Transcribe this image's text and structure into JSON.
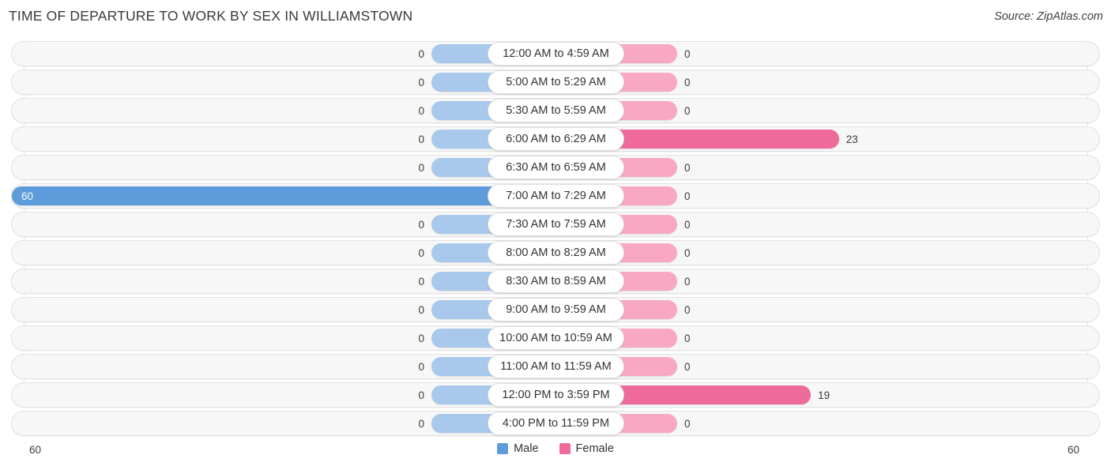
{
  "title": "TIME OF DEPARTURE TO WORK BY SEX IN WILLIAMSTOWN",
  "source": "Source: ZipAtlas.com",
  "axis": {
    "left_label": "60",
    "right_label": "60"
  },
  "legend": {
    "male": {
      "label": "Male",
      "color": "#5D9BDB"
    },
    "female": {
      "label": "Female",
      "color": "#EE6A9B"
    }
  },
  "colors": {
    "male_strong": "#5D9BDB",
    "male_light": "#A8C8EC",
    "female_strong": "#EE6A9B",
    "female_light": "#F9A8C4",
    "track": "#f7f7f7",
    "track_border": "#e2e2e2",
    "gridline": "#e4e4e4"
  },
  "chart_data": {
    "type": "bar",
    "title": "TIME OF DEPARTURE TO WORK BY SEX IN WILLIAMSTOWN",
    "subtitle": "Source: ZipAtlas.com",
    "orientation": "horizontal-diverging",
    "xlabel": "",
    "ylabel": "",
    "xlim": [
      60,
      60
    ],
    "axis_left_max": 60,
    "axis_right_max": 60,
    "grid": true,
    "legend_position": "bottom-center",
    "categories": [
      "12:00 AM to 4:59 AM",
      "5:00 AM to 5:29 AM",
      "5:30 AM to 5:59 AM",
      "6:00 AM to 6:29 AM",
      "6:30 AM to 6:59 AM",
      "7:00 AM to 7:29 AM",
      "7:30 AM to 7:59 AM",
      "8:00 AM to 8:29 AM",
      "8:30 AM to 8:59 AM",
      "9:00 AM to 9:59 AM",
      "10:00 AM to 10:59 AM",
      "11:00 AM to 11:59 AM",
      "12:00 PM to 3:59 PM",
      "4:00 PM to 11:59 PM"
    ],
    "series": [
      {
        "name": "Male",
        "color": "#5D9BDB",
        "values": [
          0,
          0,
          0,
          0,
          0,
          60,
          0,
          0,
          0,
          0,
          0,
          0,
          0,
          0
        ]
      },
      {
        "name": "Female",
        "color": "#EE6A9B",
        "values": [
          0,
          0,
          0,
          23,
          0,
          0,
          0,
          0,
          0,
          0,
          0,
          0,
          19,
          0
        ]
      }
    ]
  },
  "rows": [
    {
      "category": "12:00 AM to 4:59 AM",
      "male": "0",
      "female": "0"
    },
    {
      "category": "5:00 AM to 5:29 AM",
      "male": "0",
      "female": "0"
    },
    {
      "category": "5:30 AM to 5:59 AM",
      "male": "0",
      "female": "0"
    },
    {
      "category": "6:00 AM to 6:29 AM",
      "male": "0",
      "female": "23"
    },
    {
      "category": "6:30 AM to 6:59 AM",
      "male": "0",
      "female": "0"
    },
    {
      "category": "7:00 AM to 7:29 AM",
      "male": "60",
      "female": "0"
    },
    {
      "category": "7:30 AM to 7:59 AM",
      "male": "0",
      "female": "0"
    },
    {
      "category": "8:00 AM to 8:29 AM",
      "male": "0",
      "female": "0"
    },
    {
      "category": "8:30 AM to 8:59 AM",
      "male": "0",
      "female": "0"
    },
    {
      "category": "9:00 AM to 9:59 AM",
      "male": "0",
      "female": "0"
    },
    {
      "category": "10:00 AM to 10:59 AM",
      "male": "0",
      "female": "0"
    },
    {
      "category": "11:00 AM to 11:59 AM",
      "male": "0",
      "female": "0"
    },
    {
      "category": "12:00 PM to 3:59 PM",
      "male": "0",
      "female": "19"
    },
    {
      "category": "4:00 PM to 11:59 PM",
      "male": "0",
      "female": "0"
    }
  ]
}
